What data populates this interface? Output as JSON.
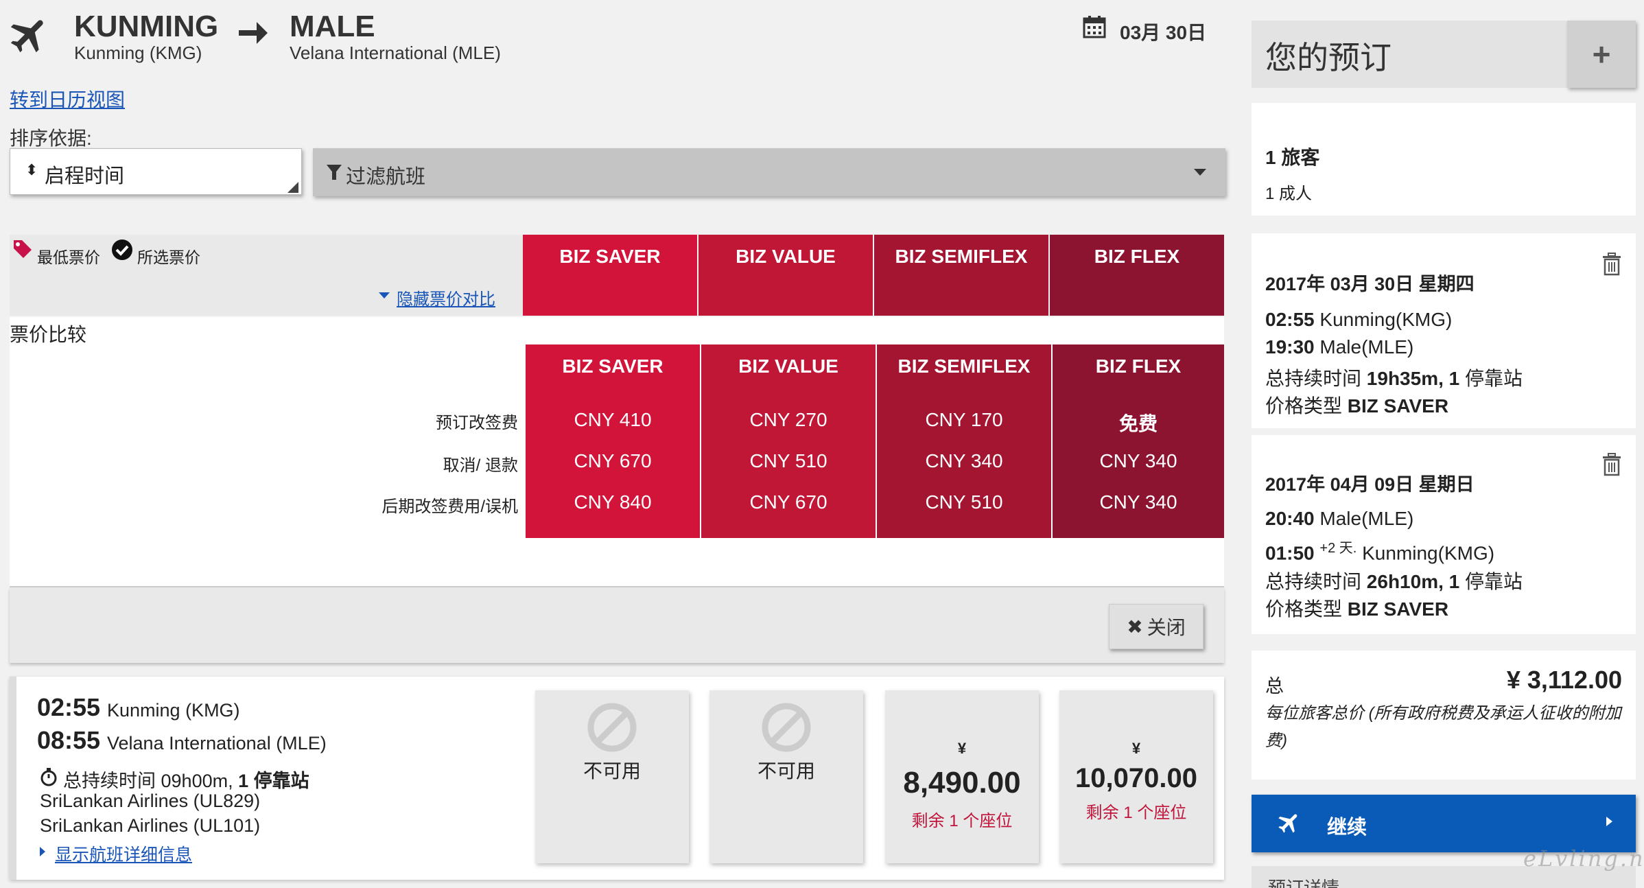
{
  "header": {
    "origin_code": "KUNMING",
    "origin_name": "Kunming (KMG)",
    "dest_code": "MALE",
    "dest_name": "Velana International (MLE)",
    "date": "03月 30日"
  },
  "calendar_link": "转到日历视图",
  "sort": {
    "label": "排序依据:",
    "value": "启程时间",
    "filter_label": "过滤航班"
  },
  "legend": {
    "lowest": "最低票价",
    "selected": "所选票价",
    "hide_compare": "隐藏票价对比",
    "compare_title": "票价比较"
  },
  "fare_columns": [
    "BIZ SAVER",
    "BIZ VALUE",
    "BIZ SEMIFLEX",
    "BIZ FLEX"
  ],
  "compare": {
    "row_labels": [
      "预订改签费",
      "取消/ 退款",
      "后期改签费用/误机"
    ],
    "columns": [
      {
        "name": "BIZ SAVER",
        "values": [
          "CNY 410",
          "CNY 670",
          "CNY 840"
        ]
      },
      {
        "name": "BIZ VALUE",
        "values": [
          "CNY 270",
          "CNY 510",
          "CNY 670"
        ]
      },
      {
        "name": "BIZ SEMIFLEX",
        "values": [
          "CNY 170",
          "CNY 340",
          "CNY 510"
        ]
      },
      {
        "name": "BIZ FLEX",
        "values": [
          "免费",
          "CNY 340",
          "CNY 340"
        ]
      }
    ],
    "close": "关闭"
  },
  "flight": {
    "dep_time": "02:55",
    "dep_place": "Kunming (KMG)",
    "arr_time": "08:55",
    "arr_place": "Velana International (MLE)",
    "duration_label": "总持续时间",
    "duration": "09h00m,",
    "stops": "1 停靠站",
    "airline1": "SriLankan Airlines (UL829)",
    "airline2": "SriLankan Airlines (UL101)",
    "details_link": "显示航班详细信息",
    "fares": [
      {
        "status": "不可用"
      },
      {
        "status": "不可用"
      },
      {
        "currency": "¥",
        "price": "8,490.00",
        "seats": "剩余 1 个座位"
      },
      {
        "currency": "¥",
        "price": "10,070.00",
        "seats": "剩余 1 个座位"
      }
    ]
  },
  "booking": {
    "title": "您的预订",
    "travelers": "1 旅客",
    "adults": "1 成人",
    "seg1": {
      "date": "2017年 03月 30日 星期四",
      "dep_time": "02:55",
      "dep_place": "Kunming(KMG)",
      "arr_time": "19:30",
      "arr_place": "Male(MLE)",
      "duration_label": "总持续时间",
      "duration": "19h35m, 1",
      "stops_suffix": "停靠站",
      "fare_label": "价格类型",
      "fare": "BIZ SAVER"
    },
    "seg2": {
      "date": "2017年 04月 09日 星期日",
      "dep_time": "20:40",
      "dep_place": "Male(MLE)",
      "arr_time": "01:50",
      "plus_days": "+2 天.",
      "arr_place": "Kunming(KMG)",
      "duration_label": "总持续时间",
      "duration": "26h10m, 1",
      "stops_suffix": "停靠站",
      "fare_label": "价格类型",
      "fare": "BIZ SAVER"
    },
    "total_label": "总",
    "total": "¥ 3,112.00",
    "total_note": "每位旅客总价 (所有政府税费及承运人征收的附加费)",
    "continue": "继续",
    "details_title": "预订详情"
  },
  "watermark": "eLvling.net",
  "colors": {
    "accent_blue": "#0a5bb8",
    "fare_red_1": "#d2143a",
    "fare_red_2": "#c01737",
    "fare_red_3": "#a31530",
    "fare_red_4": "#8d1430",
    "seat_red": "#c0143a"
  }
}
